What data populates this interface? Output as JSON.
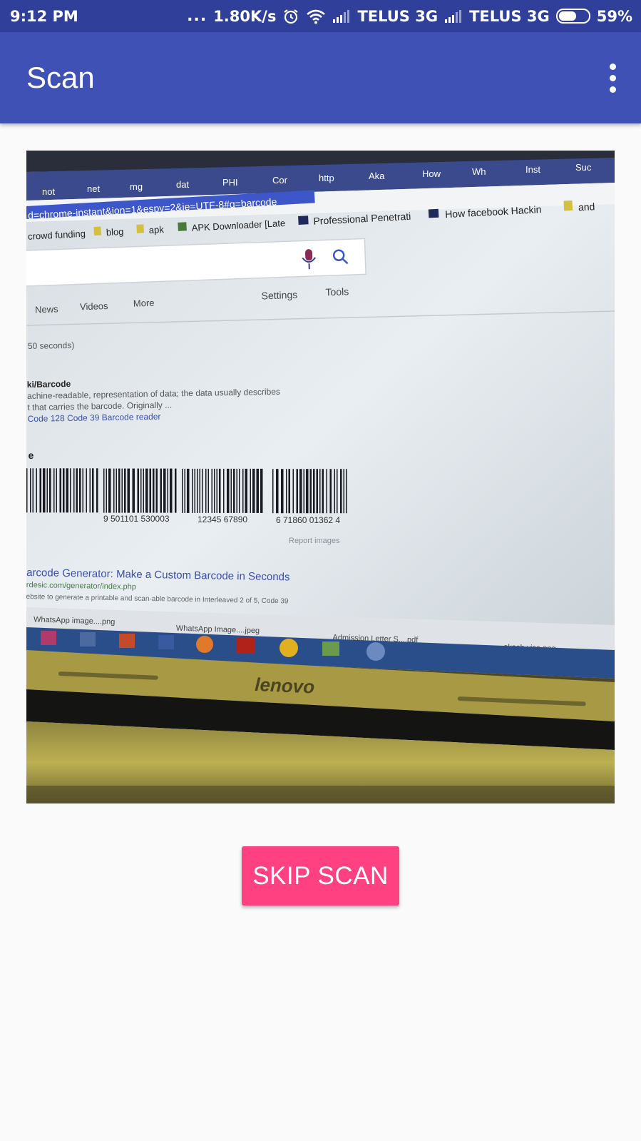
{
  "status_bar": {
    "time": "9:12 PM",
    "dots": "...",
    "speed": "1.80K/s",
    "carrier1": "TELUS 3G",
    "carrier2": "TELUS 3G",
    "battery": "59%",
    "battery_level": 0.59,
    "icons": [
      "alarm-icon",
      "wifi-icon",
      "signal-icon",
      "signal-icon",
      "battery-icon"
    ]
  },
  "app_bar": {
    "title": "Scan",
    "menu_icon": "more-vert-icon",
    "color": "#3f51b5"
  },
  "camera_preview": {
    "tabs": [
      "not",
      "net",
      "mg",
      "dat",
      "PHI",
      "Cor",
      "http",
      "Aka",
      "How",
      "Wh",
      "Inst",
      "Suc"
    ],
    "url": "d=chrome-instant&ion=1&espv=2&ie=UTF-8#q=barcode",
    "bookmarks": [
      "crowd funding",
      "blog",
      "apk",
      "APK Downloader [Late",
      "Professional Penetrati",
      "How facebook Hackin",
      "and"
    ],
    "search_nav": [
      "News",
      "Videos",
      "More",
      "Settings",
      "Tools"
    ],
    "result_time": "50 seconds)",
    "result1_title": "ki/Barcode",
    "result1_line1": "achine-readable, representation of data; the data usually describes",
    "result1_line2": "t that carries the barcode. Originally ...",
    "result1_links": "Code 128   Code 39   Barcode reader",
    "images_heading": "e",
    "barcode_numbers": [
      "9 501101 530003",
      "12345 67890",
      "6  71860  01362  4"
    ],
    "report_images": "Report images",
    "result2_title": "arcode Generator: Make a Custom Barcode in Seconds",
    "result2_url": "rdesic.com/generator/index.php",
    "result2_snippet": "ebsite to generate a printable and scan-able barcode in Interleaved 2 of 5, Code 39",
    "downloads": [
      "WhatsApp image....png",
      "WhatsApp Image....jpeg",
      "Admission Letter S....pdf",
      "akash visa.png"
    ],
    "laptop_brand": "lenovo"
  },
  "actions": {
    "skip_label": "SKIP SCAN",
    "skip_color": "#ff4081"
  }
}
